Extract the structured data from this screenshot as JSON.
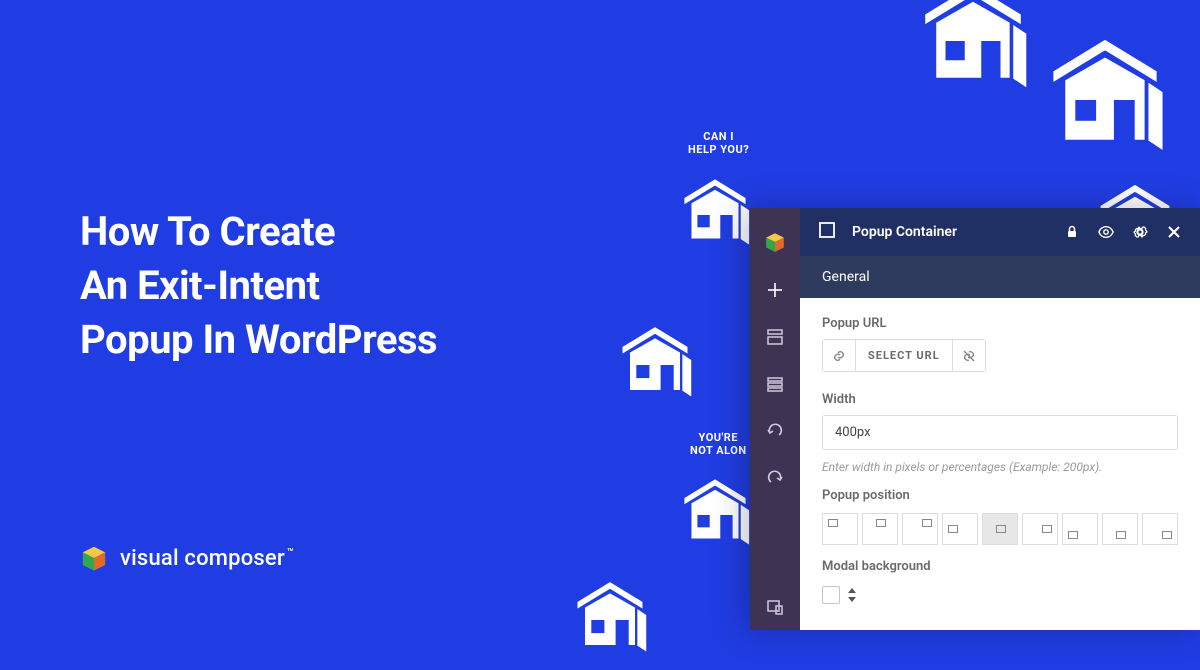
{
  "hero": {
    "line1": "How To Create",
    "line2": "An Exit-Intent",
    "line3": "Popup In WordPress"
  },
  "brand": {
    "name": "visual composer",
    "tm": "™"
  },
  "houses": {
    "label1": "CAN I\nHELP YOU?",
    "label2": "YOU'RE\nNOT ALON"
  },
  "panel": {
    "header_title": "Popup Container",
    "tab_general": "General",
    "fields": {
      "popup_url_label": "Popup URL",
      "select_url_label": "SELECT URL",
      "width_label": "Width",
      "width_value": "400px",
      "width_helper": "Enter width in pixels or percentages (Example: 200px).",
      "popup_position_label": "Popup position",
      "modal_bg_label": "Modal background"
    }
  }
}
